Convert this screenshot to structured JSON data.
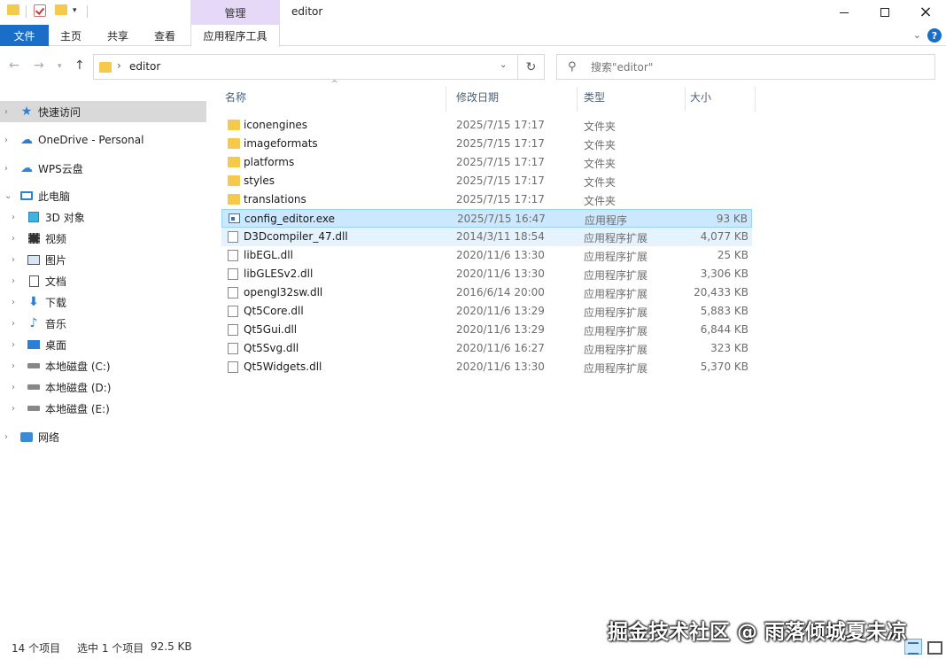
{
  "window": {
    "title": "editor",
    "contextual_tab_group": "管理"
  },
  "ribbon": {
    "tabs": [
      "文件",
      "主页",
      "共享",
      "查看",
      "应用程序工具"
    ]
  },
  "address": {
    "path": "editor",
    "search_placeholder": "搜索\"editor\""
  },
  "nav": {
    "items": [
      {
        "label": "快速访问",
        "icon": "quick-access-star-icon"
      },
      {
        "label": "OneDrive - Personal",
        "icon": "onedrive-cloud-icon"
      },
      {
        "label": "WPS云盘",
        "icon": "wps-cloud-icon"
      },
      {
        "label": "此电脑",
        "icon": "this-pc-icon"
      },
      {
        "label": "3D 对象",
        "icon": "3d-objects-icon"
      },
      {
        "label": "视频",
        "icon": "videos-icon"
      },
      {
        "label": "图片",
        "icon": "pictures-icon"
      },
      {
        "label": "文档",
        "icon": "documents-icon"
      },
      {
        "label": "下载",
        "icon": "downloads-icon"
      },
      {
        "label": "音乐",
        "icon": "music-icon"
      },
      {
        "label": "桌面",
        "icon": "desktop-icon"
      },
      {
        "label": "本地磁盘 (C:)",
        "icon": "drive-icon"
      },
      {
        "label": "本地磁盘 (D:)",
        "icon": "drive-icon"
      },
      {
        "label": "本地磁盘 (E:)",
        "icon": "drive-icon"
      },
      {
        "label": "网络",
        "icon": "network-icon"
      }
    ]
  },
  "columns": {
    "name": "名称",
    "date": "修改日期",
    "type": "类型",
    "size": "大小"
  },
  "files": [
    {
      "name": "iconengines",
      "date": "2025/7/15 17:17",
      "type": "文件夹",
      "size": "",
      "kind": "folder"
    },
    {
      "name": "imageformats",
      "date": "2025/7/15 17:17",
      "type": "文件夹",
      "size": "",
      "kind": "folder"
    },
    {
      "name": "platforms",
      "date": "2025/7/15 17:17",
      "type": "文件夹",
      "size": "",
      "kind": "folder"
    },
    {
      "name": "styles",
      "date": "2025/7/15 17:17",
      "type": "文件夹",
      "size": "",
      "kind": "folder"
    },
    {
      "name": "translations",
      "date": "2025/7/15 17:17",
      "type": "文件夹",
      "size": "",
      "kind": "folder"
    },
    {
      "name": "config_editor.exe",
      "date": "2025/7/15 16:47",
      "type": "应用程序",
      "size": "93 KB",
      "kind": "exe"
    },
    {
      "name": "D3Dcompiler_47.dll",
      "date": "2014/3/11 18:54",
      "type": "应用程序扩展",
      "size": "4,077 KB",
      "kind": "dll"
    },
    {
      "name": "libEGL.dll",
      "date": "2020/11/6 13:30",
      "type": "应用程序扩展",
      "size": "25 KB",
      "kind": "dll"
    },
    {
      "name": "libGLESv2.dll",
      "date": "2020/11/6 13:30",
      "type": "应用程序扩展",
      "size": "3,306 KB",
      "kind": "dll"
    },
    {
      "name": "opengl32sw.dll",
      "date": "2016/6/14 20:00",
      "type": "应用程序扩展",
      "size": "20,433 KB",
      "kind": "dll"
    },
    {
      "name": "Qt5Core.dll",
      "date": "2020/11/6 13:29",
      "type": "应用程序扩展",
      "size": "5,883 KB",
      "kind": "dll"
    },
    {
      "name": "Qt5Gui.dll",
      "date": "2020/11/6 13:29",
      "type": "应用程序扩展",
      "size": "6,844 KB",
      "kind": "dll"
    },
    {
      "name": "Qt5Svg.dll",
      "date": "2020/11/6 16:27",
      "type": "应用程序扩展",
      "size": "323 KB",
      "kind": "dll"
    },
    {
      "name": "Qt5Widgets.dll",
      "date": "2020/11/6 13:30",
      "type": "应用程序扩展",
      "size": "5,370 KB",
      "kind": "dll"
    }
  ],
  "status": {
    "count": "14 个项目",
    "selection": "选中 1 个项目",
    "size": "92.5 KB"
  },
  "watermark": "掘金技术社区 @ 雨落倾城夏未凉"
}
